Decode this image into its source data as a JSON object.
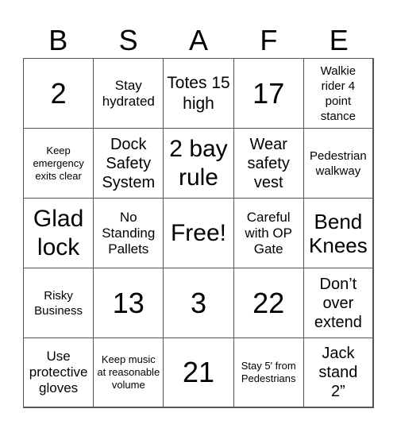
{
  "header": {
    "letters": [
      "B",
      "S",
      "A",
      "F",
      "E"
    ]
  },
  "cells": [
    [
      "2",
      "Stay hydrated",
      "Totes 15 high",
      "17",
      "Walkie rider 4 point stance"
    ],
    [
      "Keep emergency exits clear",
      "Dock Safety System",
      "2 bay rule",
      "Wear safety vest",
      "Pedestrian walkway"
    ],
    [
      "Glad lock",
      "No Standing Pallets",
      "Free!",
      "Careful with OP Gate",
      "Bend Knees"
    ],
    [
      "Risky Business",
      "13",
      "3",
      "22",
      "Don’t over extend"
    ],
    [
      "Use protective gloves",
      "Keep music at reasonable volume",
      "21",
      "Stay 5' from Pedestrians",
      "Jack stand 2”"
    ]
  ]
}
